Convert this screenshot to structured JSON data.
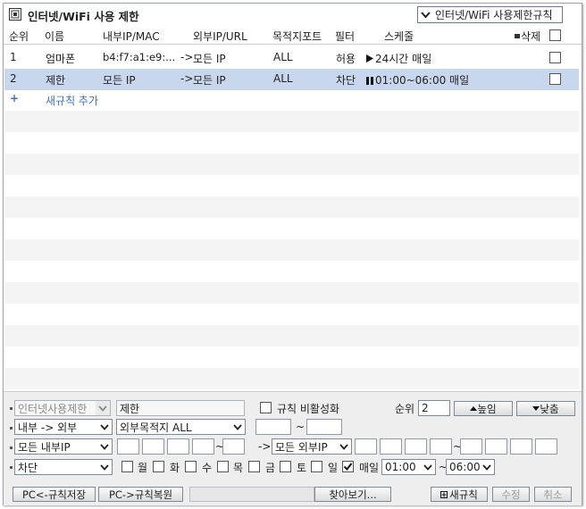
{
  "window": {
    "title": "인터넷/WiFi 사용 제한"
  },
  "rule_selector": {
    "value": "인터넷/WiFi 사용제한규칙"
  },
  "columns": {
    "order": "순위",
    "name": "이름",
    "internal": "내부IP/MAC",
    "external": "외부IP/URL",
    "port": "목적지포트",
    "filter": "필터",
    "schedule": "스케줄",
    "delete": "삭제"
  },
  "rules": [
    {
      "order": "1",
      "name": "엄마폰",
      "internal": "b4:f7:a1:e9:...",
      "external": "모든 IP",
      "port": "ALL",
      "filter": "허용",
      "schedule": "24시간 매일",
      "schedule_icon": "play-icon"
    },
    {
      "order": "2",
      "name": "제한",
      "internal": "모든 IP",
      "external": "모든 IP",
      "port": "ALL",
      "filter": "차단",
      "schedule": "01:00~06:00 매일",
      "schedule_icon": "pause-icon"
    }
  ],
  "add_rule": {
    "label": "새규칙 추가"
  },
  "editor": {
    "type_select": "인터넷사용제한",
    "name_value": "제한",
    "disable_label": "규칙 비활성화",
    "priority_label": "순위",
    "priority_value": "2",
    "raise_label": "높임",
    "lower_label": "낮춤",
    "direction_select": "내부 -> 외부",
    "dest_select": "외부목적지 ALL",
    "tilde": "~",
    "internal_select": "모든 내부IP",
    "external_arrow": "->",
    "external_select": "모든 외부IP",
    "action_select": "차단",
    "days": [
      "월",
      "화",
      "수",
      "목",
      "금",
      "토",
      "일"
    ],
    "everyday_label": "매일",
    "everyday_checked": true,
    "start_time": "01:00",
    "end_time": "06:00"
  },
  "footer": {
    "save_label": "PC<-규칙저장",
    "restore_label": "PC->규칙복원",
    "browse_label": "찾아보기...",
    "new_rule_label": "새규칙",
    "modify_label": "수정",
    "cancel_label": "취소"
  }
}
